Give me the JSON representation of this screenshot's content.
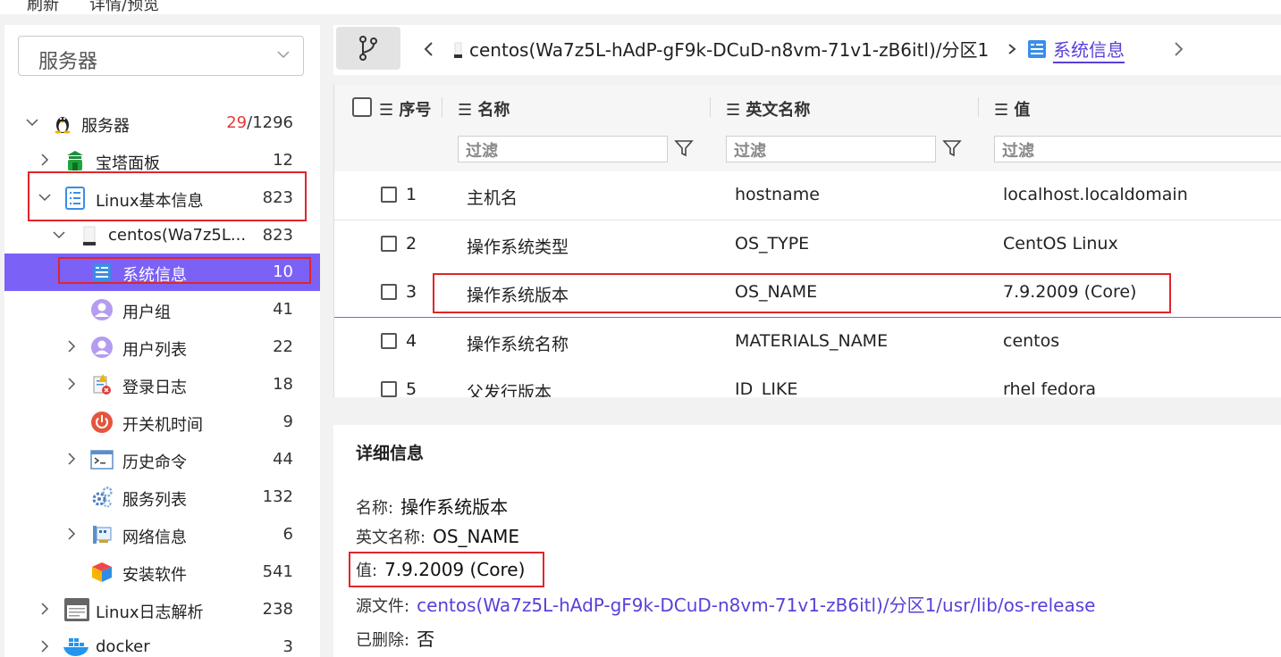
{
  "top_menu": {
    "items": [
      "刷新",
      "详情/预览"
    ]
  },
  "left": {
    "select": {
      "value": "服务器"
    },
    "tree": [
      {
        "label": "服务器",
        "count_highlight": "29",
        "count_rest": "/1296",
        "icon": "linux-penguin-icon"
      },
      {
        "label": "宝塔面板",
        "count": "12",
        "icon": "baota-icon"
      },
      {
        "label": "Linux基本信息",
        "count": "823",
        "icon": "list-document-icon"
      },
      {
        "label": "centos(Wa7z5L...",
        "count": "823",
        "icon": "disk-icon"
      },
      {
        "label": "系统信息",
        "count": "10",
        "icon": "system-info-icon"
      },
      {
        "label": "用户组",
        "count": "41",
        "icon": "user-group-icon"
      },
      {
        "label": "用户列表",
        "count": "22",
        "icon": "user-list-icon"
      },
      {
        "label": "登录日志",
        "count": "18",
        "icon": "login-log-icon"
      },
      {
        "label": "开关机时间",
        "count": "9",
        "icon": "power-icon"
      },
      {
        "label": "历史命令",
        "count": "44",
        "icon": "terminal-icon"
      },
      {
        "label": "服务列表",
        "count": "132",
        "icon": "gear-cluster-icon"
      },
      {
        "label": "网络信息",
        "count": "6",
        "icon": "network-card-icon"
      },
      {
        "label": "安装软件",
        "count": "541",
        "icon": "package-cube-icon"
      },
      {
        "label": "Linux日志解析",
        "count": "238",
        "icon": "log-icon"
      },
      {
        "label": "docker",
        "count": "3",
        "icon": "docker-whale-icon"
      }
    ]
  },
  "breadcrumb": {
    "path": "centos(Wa7z5L-hAdP-gF9k-DCuD-n8vm-71v1-zB6itl)/分区1",
    "current": "系统信息"
  },
  "table": {
    "headers": {
      "seq": "序号",
      "name": "名称",
      "en_name": "英文名称",
      "value": "值"
    },
    "filter_placeholder": "过滤",
    "rows": [
      {
        "seq": "1",
        "name": "主机名",
        "en": "hostname",
        "value": "localhost.localdomain"
      },
      {
        "seq": "2",
        "name": "操作系统类型",
        "en": "OS_TYPE",
        "value": "CentOS Linux"
      },
      {
        "seq": "3",
        "name": "操作系统版本",
        "en": "OS_NAME",
        "value": "7.9.2009 (Core)"
      },
      {
        "seq": "4",
        "name": "操作系统名称",
        "en": "MATERIALS_NAME",
        "value": "centos"
      },
      {
        "seq": "5",
        "name": "父发行版本",
        "en": "ID_LIKE",
        "value": "rhel fedora"
      }
    ]
  },
  "detail": {
    "title": "详细信息",
    "name_label": "名称:",
    "name_value": "操作系统版本",
    "en_label": "英文名称:",
    "en_value": "OS_NAME",
    "value_label": "值:",
    "value_value": "7.9.2009 (Core)",
    "source_label": "源文件:",
    "source_value": "centos(Wa7z5L-hAdP-gF9k-DCuD-n8vm-71v1-zB6itl)/分区1/usr/lib/os-release",
    "deleted_label": "已删除:",
    "deleted_value": "否"
  },
  "colors": {
    "accent": "#7b61f5",
    "highlight_box": "#e0252b",
    "link": "#5b3fd9"
  }
}
